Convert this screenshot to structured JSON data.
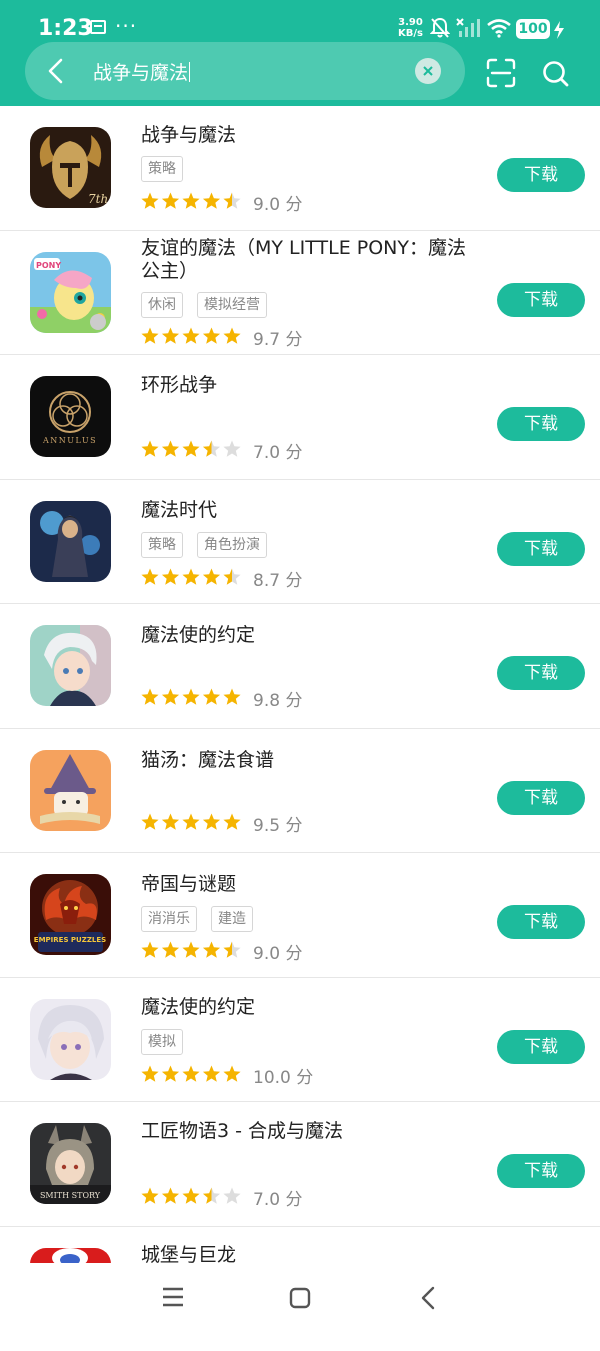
{
  "status_bar": {
    "time": "1:23",
    "more": "···",
    "speed_value": "3.90",
    "speed_unit": "KB/s",
    "battery": "100"
  },
  "search": {
    "query": "战争与魔法",
    "icons": [
      "back-arrow-icon",
      "clear-icon",
      "scan-icon",
      "search-icon"
    ]
  },
  "colors": {
    "accent": "#1dbb9c",
    "star": "#f5b400",
    "star_empty": "#dddddd"
  },
  "results": [
    {
      "name": "战争与魔法",
      "tags": [
        "策略"
      ],
      "rating": 4.5,
      "score": "9.0 分",
      "button": "下载"
    },
    {
      "name": "友谊的魔法（MY LITTLE PONY：魔法公主）",
      "tags": [
        "休闲",
        "模拟经营"
      ],
      "rating": 5,
      "score": "9.7 分",
      "button": "下载"
    },
    {
      "name": "环形战争",
      "tags": [],
      "rating": 3.5,
      "score": "7.0 分",
      "button": "下载"
    },
    {
      "name": "魔法时代",
      "tags": [
        "策略",
        "角色扮演"
      ],
      "rating": 4.5,
      "score": "8.7 分",
      "button": "下载"
    },
    {
      "name": "魔法使的约定",
      "tags": [],
      "rating": 5,
      "score": "9.8 分",
      "button": "下载"
    },
    {
      "name": "猫汤：魔法食谱",
      "tags": [],
      "rating": 5,
      "score": "9.5 分",
      "button": "下载"
    },
    {
      "name": "帝国与谜题",
      "tags": [
        "消消乐",
        "建造"
      ],
      "rating": 4.5,
      "score": "9.0 分",
      "button": "下载"
    },
    {
      "name": "魔法使的约定",
      "tags": [
        "模拟"
      ],
      "rating": 5,
      "score": "10.0 分",
      "button": "下载"
    },
    {
      "name": "工匠物语3 - 合成与魔法",
      "tags": [],
      "rating": 3.5,
      "score": "7.0 分",
      "button": "下载"
    },
    {
      "name": "城堡与巨龙",
      "tags": [],
      "rating": null,
      "score": null,
      "button": null
    }
  ],
  "icon_art_text": {
    "row0": "7th",
    "row1": "PONY",
    "row2": "ANNULUS",
    "row6": "EMPIRES PUZZLES",
    "row8": "SMITH STORY"
  },
  "nav_bar": {
    "icons": [
      "menu-icon",
      "home-icon",
      "back-icon"
    ]
  }
}
